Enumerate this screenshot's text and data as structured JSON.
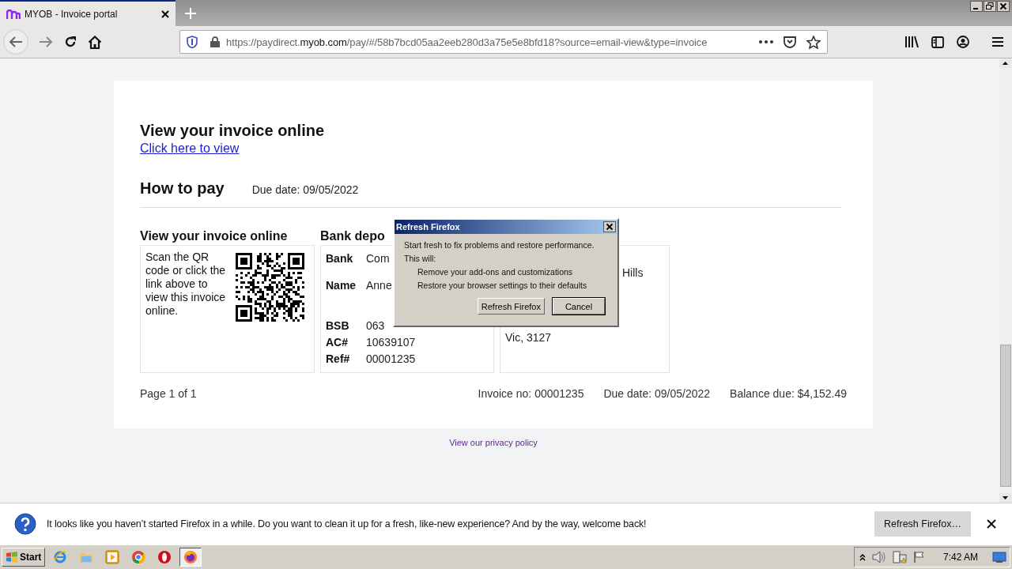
{
  "browser": {
    "tab": {
      "title": "MYOB - Invoice portal",
      "selected": true
    },
    "url": {
      "before": "https://paydirect.",
      "domain": "myob.com",
      "after": "/pay/#/58b7bcd05aa2eeb280d3a75e5e8bfd18?source=email-view&type=invoice"
    }
  },
  "invoice": {
    "online": {
      "heading": "View your invoice online",
      "link": "Click here to view"
    },
    "how_to_pay": {
      "heading": "How to pay",
      "due_date": "Due date: 09/05/2022"
    },
    "columns": [
      {
        "kind": "qr",
        "heading": "View your invoice online",
        "text": "Scan the QR code or click the link above to view this invoice online."
      },
      {
        "kind": "bank",
        "heading": "Bank depo",
        "rows": [
          {
            "label": "Bank",
            "value": "Com"
          },
          {
            "label": "Name",
            "value": "Anne"
          },
          {
            "label": "BSB",
            "value": "063"
          },
          {
            "label": "AC#",
            "value": "10639107"
          },
          {
            "label": "Ref#",
            "value": "00001235"
          }
        ]
      },
      {
        "kind": "address",
        "lines": [
          "Hills",
          "Vic, 3127"
        ]
      }
    ],
    "footer": {
      "page": "Page 1 of 1",
      "invoice_no": "Invoice no: 00001235",
      "due_date": "Due date: 09/05/2022",
      "balance": "Balance due: $4,152.49"
    }
  },
  "privacy_link": "View our privacy policy",
  "dialog": {
    "title": "Refresh Firefox",
    "intro": "Start fresh to fix problems and restore performance.",
    "lead": "This will:",
    "items": [
      "Remove your add-ons and customizations",
      "Restore your browser settings to their defaults"
    ],
    "buttons": [
      {
        "label": "Refresh Firefox",
        "selected": false
      },
      {
        "label": "Cancel",
        "selected": true
      }
    ]
  },
  "notification": {
    "message": "It looks like you haven’t started Firefox in a while. Do you want to clean it up for a fresh, like-new experience? And by the way, welcome back!",
    "button": "Refresh Firefox…"
  },
  "taskbar": {
    "start": "Start",
    "apps": [
      {
        "kind": "ie",
        "selected": false
      },
      {
        "kind": "folder",
        "selected": false
      },
      {
        "kind": "media",
        "selected": false
      },
      {
        "kind": "chrome",
        "selected": false
      },
      {
        "kind": "opera",
        "selected": false
      },
      {
        "kind": "firefox",
        "selected": true
      }
    ],
    "clock": "7:42 AM"
  }
}
